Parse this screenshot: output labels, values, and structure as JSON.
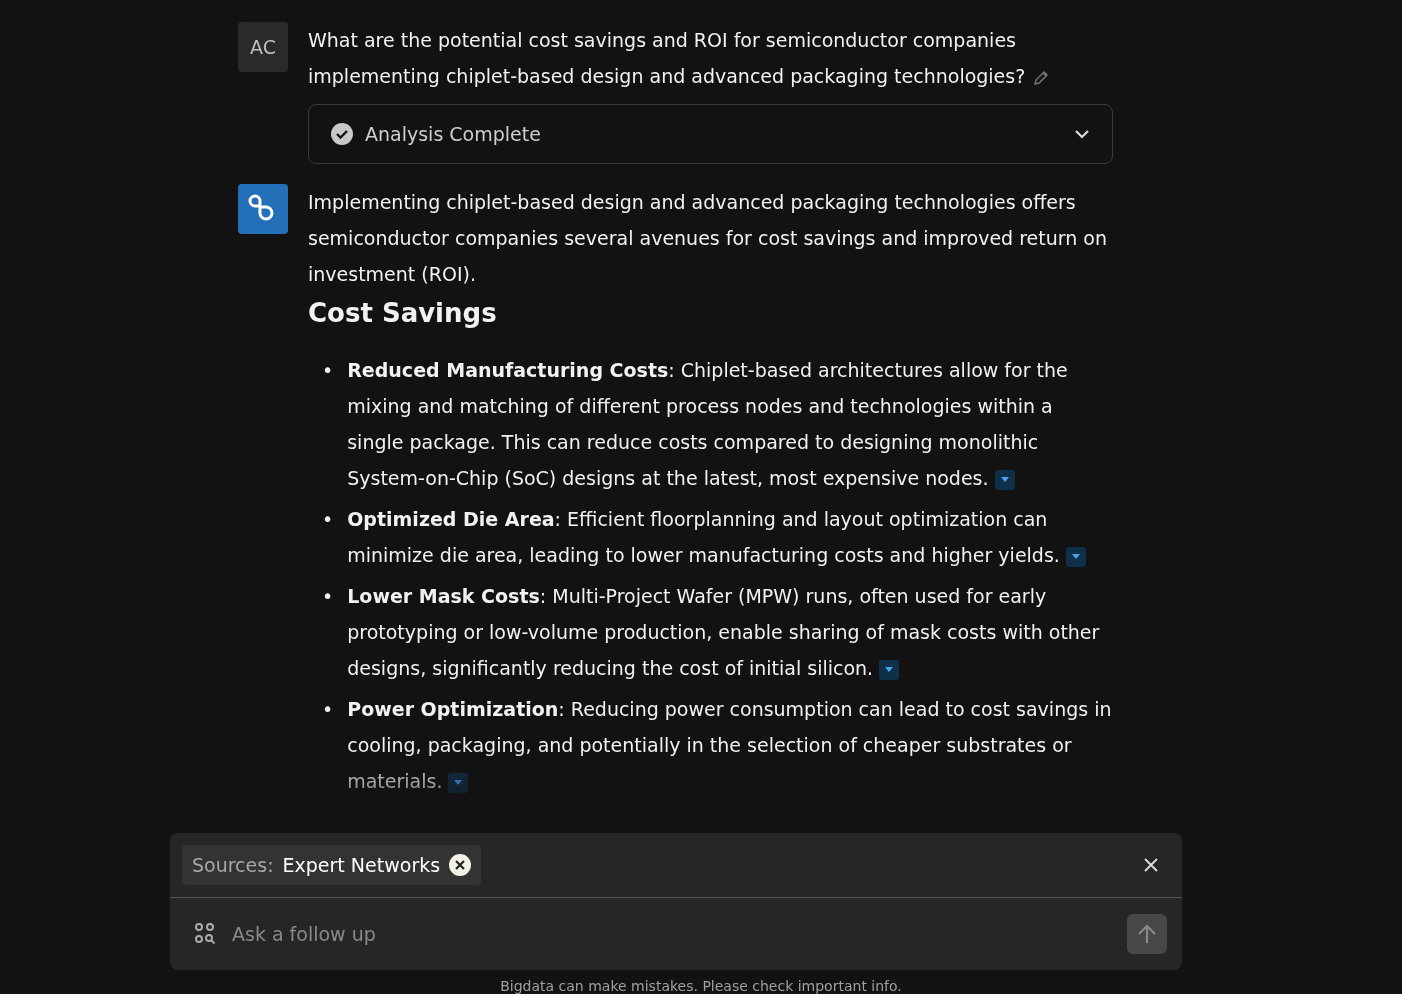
{
  "question": {
    "avatar": "AC",
    "text": "What are the potential cost savings and ROI for semiconductor companies implementing chiplet-based design and advanced packaging technologies?"
  },
  "analysis": {
    "label": "Analysis Complete",
    "expanded": false
  },
  "answer": {
    "intro": "Implementing chiplet-based design and advanced packaging technologies offers semiconductor companies several avenues for cost savings and improved return on investment (ROI).",
    "heading": "Cost Savings",
    "bullets": [
      {
        "text": "**Reduced Manufacturing Costs**: Chiplet-based architectures allow for the mixing and matching of different process nodes and technologies within a single package. This can reduce costs compared to designing monolithic System-on-Chip (SoC) designs at the latest, most expensive nodes.",
        "marker": "•"
      },
      {
        "text": "**Optimized Die Area**: Efficient floorplanning and layout optimization can minimize die area, leading to lower manufacturing costs and higher yields.",
        "marker": "•"
      },
      {
        "text": "**Lower Mask Costs**: Multi-Project Wafer (MPW) runs, often used for early prototyping or low-volume production, enable sharing of mask costs with other designs, significantly reducing the cost of initial silicon.",
        "marker": "•"
      },
      {
        "text": "**Power Optimization**: Reducing power consumption can lead to cost savings in cooling, packaging, and potentially in the selection of cheaper substrates or materials.",
        "marker": "•"
      }
    ]
  },
  "composer": {
    "sources_label": "Sources:",
    "source": "Expert Networks",
    "placeholder": "Ask a follow up"
  },
  "disclaimer": "Bigdata can make mistakes. Please check important info."
}
